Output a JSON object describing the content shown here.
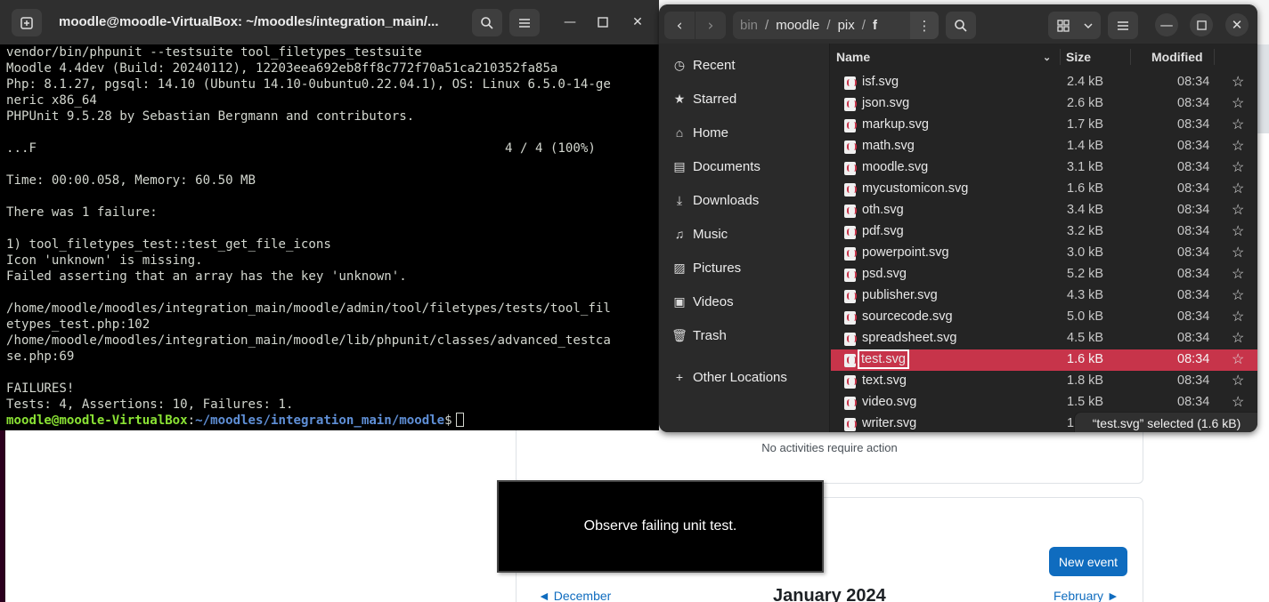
{
  "terminal": {
    "title": "moodle@moodle-VirtualBox: ~/moodles/integration_main/...",
    "lines": [
      "vendor/bin/phpunit --testsuite tool_filetypes_testsuite",
      "Moodle 4.4dev (Build: 20240112), 12203eea692eb8ff8c772f70a51ca210352fa85a",
      "Php: 8.1.27, pgsql: 14.10 (Ubuntu 14.10-0ubuntu0.22.04.1), OS: Linux 6.5.0-14-ge",
      "neric x86_64",
      "PHPUnit 9.5.28 by Sebastian Bergmann and contributors.",
      "",
      "...F                                                              4 / 4 (100%)",
      "",
      "Time: 00:00.058, Memory: 60.50 MB",
      "",
      "There was 1 failure:",
      "",
      "1) tool_filetypes_test::test_get_file_icons",
      "Icon 'unknown' is missing.",
      "Failed asserting that an array has the key 'unknown'.",
      "",
      "/home/moodle/moodles/integration_main/moodle/admin/tool/filetypes/tests/tool_fil",
      "etypes_test.php:102",
      "/home/moodle/moodles/integration_main/moodle/lib/phpunit/classes/advanced_testca",
      "se.php:69",
      "",
      "FAILURES!",
      "Tests: 4, Assertions: 10, Failures: 1."
    ],
    "prompt_user": "moodle@moodle-VirtualBox",
    "prompt_sep": ":",
    "prompt_path": "~/moodles/integration_main/moodle",
    "prompt_symbol": "$"
  },
  "files": {
    "path": [
      "bin",
      "moodle",
      "pix",
      "f"
    ],
    "sidebar": [
      {
        "label": "Recent",
        "icon": "clock-icon"
      },
      {
        "label": "Starred",
        "icon": "star-icon"
      },
      {
        "label": "Home",
        "icon": "home-icon"
      },
      {
        "label": "Documents",
        "icon": "document-icon"
      },
      {
        "label": "Downloads",
        "icon": "download-icon"
      },
      {
        "label": "Music",
        "icon": "music-icon"
      },
      {
        "label": "Pictures",
        "icon": "picture-icon"
      },
      {
        "label": "Videos",
        "icon": "video-icon"
      },
      {
        "label": "Trash",
        "icon": "trash-icon"
      },
      {
        "label": "Other Locations",
        "icon": "plus-icon"
      }
    ],
    "columns": {
      "name": "Name",
      "size": "Size",
      "modified": "Modified"
    },
    "rows": [
      {
        "name": "isf.svg",
        "size": "2.4 kB",
        "modified": "08:34"
      },
      {
        "name": "json.svg",
        "size": "2.6 kB",
        "modified": "08:34"
      },
      {
        "name": "markup.svg",
        "size": "1.7 kB",
        "modified": "08:34"
      },
      {
        "name": "math.svg",
        "size": "1.4 kB",
        "modified": "08:34"
      },
      {
        "name": "moodle.svg",
        "size": "3.1 kB",
        "modified": "08:34"
      },
      {
        "name": "mycustomicon.svg",
        "size": "1.6 kB",
        "modified": "08:34"
      },
      {
        "name": "oth.svg",
        "size": "3.4 kB",
        "modified": "08:34"
      },
      {
        "name": "pdf.svg",
        "size": "3.2 kB",
        "modified": "08:34"
      },
      {
        "name": "powerpoint.svg",
        "size": "3.0 kB",
        "modified": "08:34"
      },
      {
        "name": "psd.svg",
        "size": "5.2 kB",
        "modified": "08:34"
      },
      {
        "name": "publisher.svg",
        "size": "4.3 kB",
        "modified": "08:34"
      },
      {
        "name": "sourcecode.svg",
        "size": "5.0 kB",
        "modified": "08:34"
      },
      {
        "name": "spreadsheet.svg",
        "size": "4.5 kB",
        "modified": "08:34"
      },
      {
        "name": "test.svg",
        "size": "1.6 kB",
        "modified": "08:34",
        "selected": true
      },
      {
        "name": "text.svg",
        "size": "1.8 kB",
        "modified": "08:34"
      },
      {
        "name": "video.svg",
        "size": "1.5 kB",
        "modified": "08:34"
      },
      {
        "name": "writer.svg",
        "size": "1",
        "modified": ""
      }
    ],
    "status": "“test.svg” selected  (1.6 kB)",
    "selection_color": "#c7344a"
  },
  "background": {
    "no_activities": "No activities require action",
    "new_event_label": "New event",
    "prev_month": "◄   December",
    "current_month": "January 2024",
    "next_month": "February   ►",
    "caption": "Observe failing unit test."
  }
}
